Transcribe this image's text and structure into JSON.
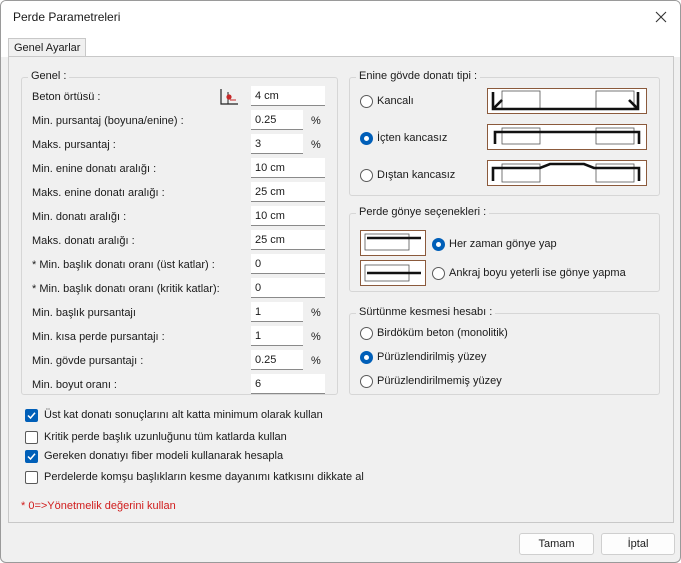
{
  "window": {
    "title": "Perde Parametreleri"
  },
  "tabs": [
    {
      "label": "Genel Ayarlar"
    }
  ],
  "genel": {
    "title": "Genel :",
    "rows": [
      {
        "label": "Beton örtüsü :",
        "value": "4 cm",
        "unit": ""
      },
      {
        "label": "Min. pursantaj (boyuna/enine) :",
        "value": "0.25",
        "unit": "%"
      },
      {
        "label": "Maks. pursantaj :",
        "value": "3",
        "unit": "%"
      },
      {
        "label": "Min. enine donatı aralığı :",
        "value": "10 cm",
        "unit": ""
      },
      {
        "label": "Maks. enine donatı aralığı :",
        "value": "25 cm",
        "unit": ""
      },
      {
        "label": "Min. donatı aralığı :",
        "value": "10 cm",
        "unit": ""
      },
      {
        "label": "Maks. donatı aralığı :",
        "value": "25 cm",
        "unit": ""
      },
      {
        "label": "* Min. başlık donatı oranı (üst katlar) :",
        "value": "0",
        "unit": ""
      },
      {
        "label": "* Min. başlık donatı oranı (kritik katlar):",
        "value": "0",
        "unit": ""
      },
      {
        "label": "Min. başlık pursantajı",
        "value": "1",
        "unit": "%"
      },
      {
        "label": "Min. kısa perde pursantajı :",
        "value": "1",
        "unit": "%"
      },
      {
        "label": "Min. gövde pursantajı :",
        "value": "0.25",
        "unit": "%"
      },
      {
        "label": "Min. boyut oranı :",
        "value": "6",
        "unit": ""
      }
    ]
  },
  "checkboxes": [
    {
      "label": "Üst kat donatı sonuçlarını alt katta minimum olarak kullan",
      "checked": true
    },
    {
      "label": "Kritik perde başlık uzunluğunu tüm katlarda kullan",
      "checked": false
    },
    {
      "label": "Gereken donatıyı fiber modeli kullanarak hesapla",
      "checked": true
    },
    {
      "label": "Perdelerde komşu başlıkların kesme dayanımı katkısını dikkate al",
      "checked": false
    }
  ],
  "enine": {
    "title": "Enine gövde donatı tipi :",
    "options": [
      {
        "label": "Kancalı",
        "checked": false
      },
      {
        "label": "İçten kancasız",
        "checked": true
      },
      {
        "label": "Dıştan kancasız",
        "checked": false
      }
    ]
  },
  "gonye": {
    "title": "Perde gönye seçenekleri :",
    "options": [
      {
        "label": "Her zaman gönye yap",
        "checked": true
      },
      {
        "label": "Ankraj boyu yeterli ise gönye yapma",
        "checked": false
      }
    ]
  },
  "surtunme": {
    "title": "Sürtünme kesmesi hesabı :",
    "options": [
      {
        "label": "Birdöküm beton (monolitik)",
        "checked": false
      },
      {
        "label": "Pürüzlendirilmiş yüzey",
        "checked": true
      },
      {
        "label": "Pürüzlendirilmemiş yüzey",
        "checked": false
      }
    ]
  },
  "note": "* 0=>Yönetmelik değerini kullan",
  "buttons": {
    "ok": "Tamam",
    "cancel": "İptal"
  },
  "colors": {
    "accent": "#005fb8",
    "note": "#d01c1c",
    "preview_border": "#8b5a3c"
  }
}
